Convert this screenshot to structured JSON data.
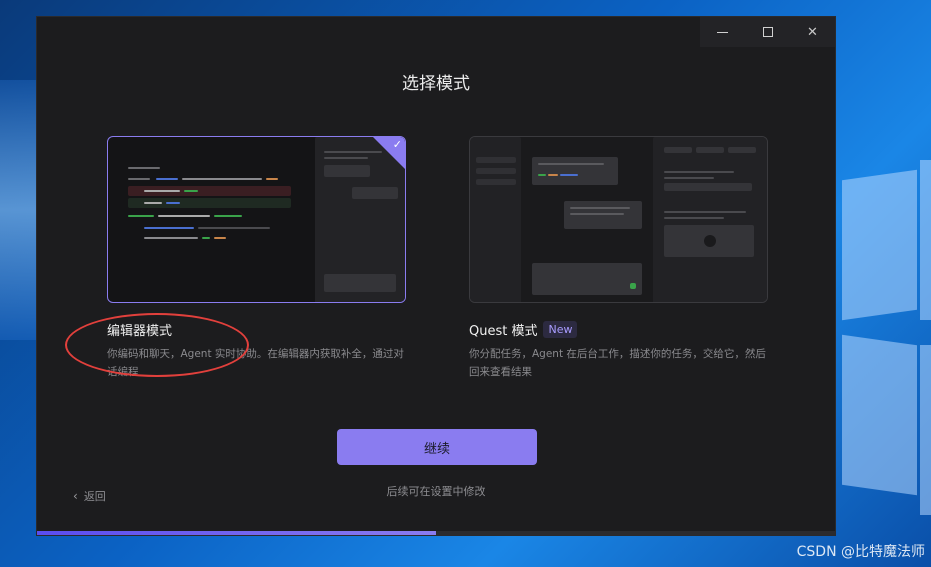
{
  "window": {
    "minimize_icon": "minimize-icon",
    "maximize_icon": "maximize-icon",
    "close_icon": "close-icon",
    "close_glyph": "✕"
  },
  "page": {
    "title": "选择模式"
  },
  "modes": [
    {
      "id": "editor",
      "title": "编辑器模式",
      "description": "你编码和聊天，Agent 实时协助。在编辑器内获取补全，通过对话编程",
      "selected": true
    },
    {
      "id": "quest",
      "title": "Quest 模式",
      "badge": "New",
      "description": "你分配任务，Agent 在后台工作，描述你的任务，交给它，然后回来查看结果",
      "selected": false
    }
  ],
  "actions": {
    "continue_label": "继续",
    "hint": "后续可在设置中修改",
    "back_label": "返回",
    "back_glyph": "‹",
    "check_glyph": "✓"
  },
  "progress": {
    "fraction": 0.5
  },
  "colors": {
    "accent": "#8a7cf0",
    "annotation": "#e2403c"
  },
  "watermark": "CSDN @比特魔法师"
}
